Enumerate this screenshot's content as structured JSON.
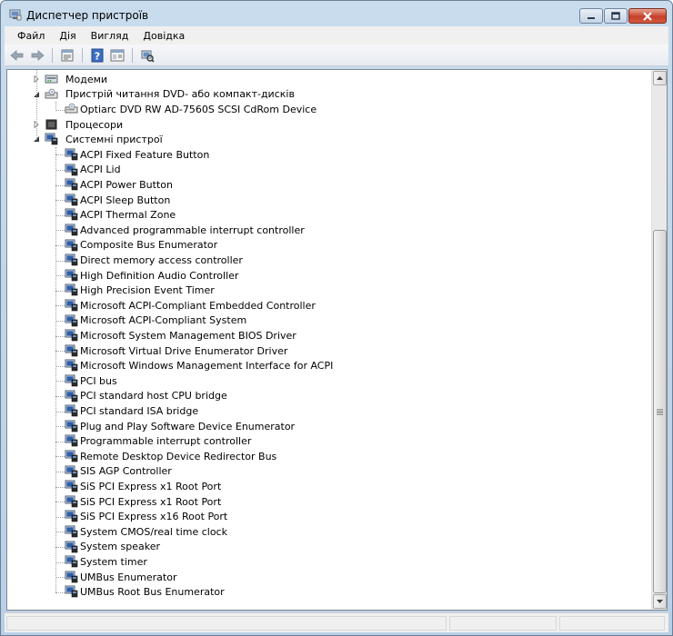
{
  "window": {
    "title": "Диспетчер пристроїв",
    "icon": "device-manager-icon"
  },
  "menu": [
    "Файл",
    "Дія",
    "Вигляд",
    "Довідка"
  ],
  "toolbar": {
    "buttons": [
      "back-arrow-icon",
      "forward-arrow-icon",
      "properties-icon",
      "help-icon",
      "view-icon",
      "scan-hardware-icon"
    ]
  },
  "tree": {
    "categories": {
      "modems": "Модеми",
      "dvd": "Пристрій читання DVD- або компакт-дисків",
      "processors": "Процесори",
      "system": "Системні пристрої"
    },
    "dvd_devices": [
      "Optiarc DVD RW AD-7560S SCSI CdRom Device"
    ],
    "system_devices": [
      "ACPI Fixed Feature Button",
      "ACPI Lid",
      "ACPI Power Button",
      "ACPI Sleep Button",
      "ACPI Thermal Zone",
      "Advanced programmable interrupt controller",
      "Composite Bus Enumerator",
      "Direct memory access controller",
      "High Definition Audio Controller",
      "High Precision Event Timer",
      "Microsoft ACPI-Compliant Embedded Controller",
      "Microsoft ACPI-Compliant System",
      "Microsoft System Management BIOS Driver",
      "Microsoft Virtual Drive Enumerator Driver",
      "Microsoft Windows Management Interface for ACPI",
      "PCI bus",
      "PCI standard host CPU bridge",
      "PCI standard ISA bridge",
      "Plug and Play Software Device Enumerator",
      "Programmable interrupt controller",
      "Remote Desktop Device Redirector Bus",
      "SIS AGP Controller",
      "SiS PCI Express x1 Root Port",
      "SiS PCI Express x1 Root Port",
      "SiS PCI Express x16 Root Port",
      "System CMOS/real time clock",
      "System speaker",
      "System timer",
      "UMBus Enumerator",
      "UMBus Root Bus Enumerator"
    ]
  },
  "colors": {
    "titlebar": "#c9dcee",
    "close_button": "#c6402a",
    "tree_line": "#a0a0a0"
  }
}
